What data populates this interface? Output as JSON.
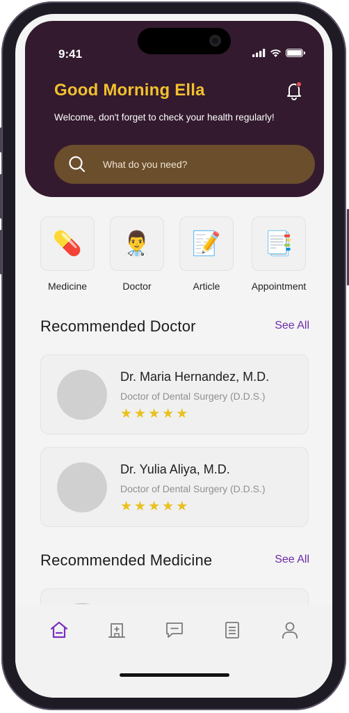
{
  "status_bar": {
    "time": "9:41"
  },
  "header": {
    "greeting": "Good Morning Ella",
    "welcome": "Welcome, don't forget to check your health regularly!",
    "search_placeholder": "What do you need?"
  },
  "categories": [
    {
      "label": "Medicine",
      "icon": "pill-icon",
      "glyph": "💊"
    },
    {
      "label": "Doctor",
      "icon": "doctor-icon",
      "glyph": "👨‍⚕️"
    },
    {
      "label": "Article",
      "icon": "memo-icon",
      "glyph": "📝"
    },
    {
      "label": "Appointment",
      "icon": "calendar-icon",
      "glyph": "📑"
    }
  ],
  "recommended_doctor": {
    "title": "Recommended Doctor",
    "see_all": "See All",
    "doctors": [
      {
        "name": "Dr. Maria Hernandez, M.D.",
        "specialty": "Doctor of Dental Surgery (D.D.S.)",
        "rating": 5
      },
      {
        "name": "Dr. Yulia Aliya, M.D.",
        "specialty": "Doctor of Dental Surgery (D.D.S.)",
        "rating": 5
      }
    ]
  },
  "recommended_medicine": {
    "title": "Recommended Medicine",
    "see_all": "See All"
  },
  "bottom_nav": {
    "items": [
      "home-icon",
      "hospital-icon",
      "chat-icon",
      "document-icon",
      "profile-icon"
    ],
    "active": "home-icon"
  },
  "colors": {
    "header_bg": "#331a2e",
    "greeting": "#f2c12e",
    "search_bg": "#6b4e2c",
    "accent": "#6c2aa8",
    "star": "#e8c11c"
  }
}
